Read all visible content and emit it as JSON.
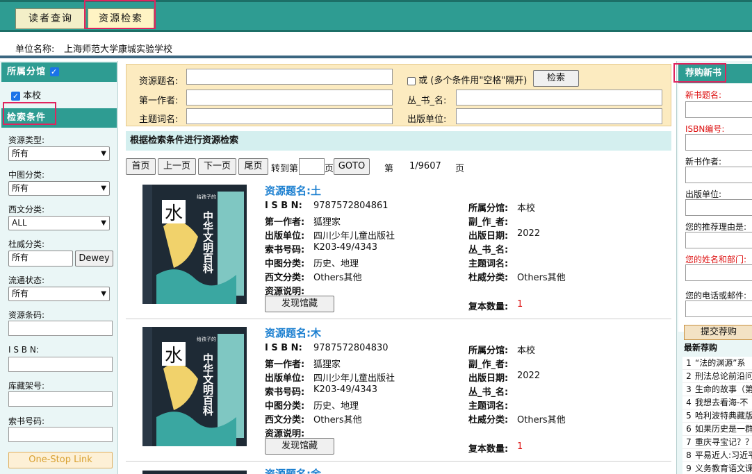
{
  "nav": {
    "tabs": [
      {
        "label": "读者查询"
      },
      {
        "label": "资源检索"
      }
    ]
  },
  "unit": {
    "label": "单位名称:",
    "name": "上海师范大学康城实验学校"
  },
  "left": {
    "branch_header": "所属分馆",
    "branch_option": "本校",
    "criteria_header": "检索条件",
    "fields": {
      "res_type": {
        "label": "资源类型:",
        "value": "所有"
      },
      "clc": {
        "label": "中图分类:",
        "value": "所有"
      },
      "western": {
        "label": "西文分类:",
        "value": "ALL"
      },
      "dewey": {
        "label": "杜威分类:",
        "value": "所有",
        "button": "Dewey"
      },
      "circ": {
        "label": "流通状态:",
        "value": "所有"
      },
      "barcode": {
        "label": "资源条码:"
      },
      "isbn": {
        "label": "I S B N:"
      },
      "shelf": {
        "label": "库藏架号:"
      },
      "callno": {
        "label": "索书号码:"
      }
    },
    "onestop": "One-Stop Link"
  },
  "search": {
    "title_label": "资源题名:",
    "author_label": "第一作者:",
    "subject_label": "主题词名:",
    "or_label": "或 (多个条件用\"空格\"隔开)",
    "search_button": "检索",
    "series_label": "丛_书_名:",
    "publisher_label": "出版单位:"
  },
  "hint": "根据检索条件进行资源检索",
  "pager": {
    "first": "首页",
    "prev": "上一页",
    "next": "下一页",
    "last": "尾页",
    "goto_prefix": "转到第",
    "goto_suffix": "页",
    "goto_button": "GOTO",
    "page_prefix": "第",
    "page_value": "1/9607",
    "page_suffix": "页"
  },
  "labels": {
    "title": "资源题名:",
    "isbn": "I S B N:",
    "author": "第一作者:",
    "publisher": "出版单位:",
    "callno": "索书号码:",
    "clc": "中图分类:",
    "western": "西文分类:",
    "note": "资源说明:",
    "branch": "所属分馆:",
    "coauthor": "副_作_者:",
    "pubdate": "出版日期:",
    "series": "丛_书_名:",
    "subject": "主题词名:",
    "dewey": "杜威分类:",
    "copies": "复本数量:",
    "find_button": "发现馆藏"
  },
  "records": [
    {
      "title": "土",
      "isbn": "9787572804861",
      "author": "狐狸家",
      "publisher": "四川少年儿童出版社",
      "callno": "K203-49/4343",
      "clc": "历史、地理",
      "western": "Others其他",
      "branch": "本校",
      "pubdate": "2022",
      "dewey": "Others其他",
      "copies": "1",
      "cover_char": "水",
      "cover_title": "中华文明百科",
      "cover_sub": "给孩子的"
    },
    {
      "title": "木",
      "isbn": "9787572804830",
      "author": "狐狸家",
      "publisher": "四川少年儿童出版社",
      "callno": "K203-49/4343",
      "clc": "历史、地理",
      "western": "Others其他",
      "branch": "本校",
      "pubdate": "2022",
      "dewey": "Others其他",
      "copies": "1",
      "cover_char": "水",
      "cover_title": "中华文明百科",
      "cover_sub": "给孩子的"
    },
    {
      "title": "金"
    }
  ],
  "right": {
    "header": "荐购新书",
    "fields": [
      {
        "label": "新书题名:"
      },
      {
        "label": "ISBN编号:"
      },
      {
        "label": "新书作者:"
      },
      {
        "label": "出版单位:"
      },
      {
        "label": "您的推荐理由是:"
      },
      {
        "label": "您的姓名和部门:"
      },
      {
        "label": "您的电话或邮件:"
      }
    ],
    "submit": "提交荐购",
    "latest_title": "最新荐购",
    "latest": [
      {
        "n": "1",
        "text": "“法的渊源”系"
      },
      {
        "n": "2",
        "text": "刑法总论前沿问"
      },
      {
        "n": "3",
        "text": "生命的故事（第"
      },
      {
        "n": "4",
        "text": "我想去看海-不"
      },
      {
        "n": "5",
        "text": "哈利波特典藏版"
      },
      {
        "n": "6",
        "text": "如果历史是一群"
      },
      {
        "n": "7",
        "text": "重庆寻宝记？？"
      },
      {
        "n": "8",
        "text": "平易近人:习近平"
      },
      {
        "n": "9",
        "text": "义务教育语文课"
      }
    ]
  },
  "colors": {
    "teal": "#2e9c92",
    "accent_red": "#e0245e",
    "title_blue": "#1b7fd0"
  }
}
